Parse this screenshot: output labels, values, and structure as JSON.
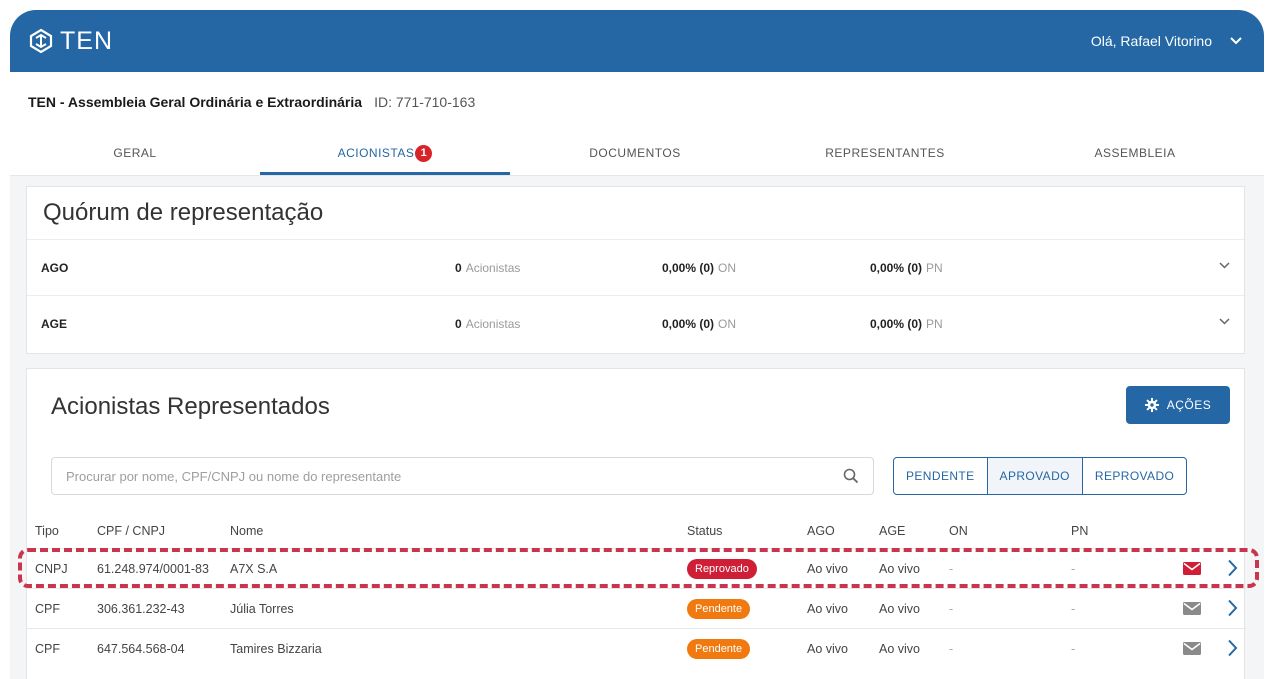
{
  "app": {
    "logo_text": "TEN",
    "user_greeting": "Olá, Rafael Vitorino"
  },
  "assembly": {
    "title": "TEN - Assembleia Geral Ordinária e Extraordinária",
    "id": "ID: 771-710-163"
  },
  "tabs": [
    {
      "label": "GERAL"
    },
    {
      "label": "ACIONISTAS",
      "badge": "1",
      "active": true
    },
    {
      "label": "DOCUMENTOS"
    },
    {
      "label": "REPRESENTANTES"
    },
    {
      "label": "ASSEMBLEIA"
    }
  ],
  "quorum": {
    "title": "Quórum de representação",
    "rows": [
      {
        "label": "AGO",
        "count": "0",
        "count_unit": "Acionistas",
        "on": "0,00% (0)",
        "on_unit": "ON",
        "pn": "0,00% (0)",
        "pn_unit": "PN"
      },
      {
        "label": "AGE",
        "count": "0",
        "count_unit": "Acionistas",
        "on": "0,00% (0)",
        "on_unit": "ON",
        "pn": "0,00% (0)",
        "pn_unit": "PN"
      }
    ]
  },
  "acionistas": {
    "title": "Acionistas Representados",
    "actions_label": "AÇÕES",
    "search_placeholder": "Procurar por nome, CPF/CNPJ ou nome do representante",
    "filters": [
      "PENDENTE",
      "APROVADO",
      "REPROVADO"
    ],
    "columns": {
      "tipo": "Tipo",
      "cpf": "CPF / CNPJ",
      "nome": "Nome",
      "status": "Status",
      "ago": "AGO",
      "age": "AGE",
      "on": "ON",
      "pn": "PN"
    },
    "rows": [
      {
        "tipo": "CNPJ",
        "cpf": "61.248.974/0001-83",
        "nome": "A7X S.A",
        "status": "Reprovado",
        "ago": "Ao vivo",
        "age": "Ao vivo",
        "on": "-",
        "pn": "-"
      },
      {
        "tipo": "CPF",
        "cpf": "306.361.232-43",
        "nome": "Júlia Torres",
        "status": "Pendente",
        "ago": "Ao vivo",
        "age": "Ao vivo",
        "on": "-",
        "pn": "-"
      },
      {
        "tipo": "CPF",
        "cpf": "647.564.568-04",
        "nome": "Tamires Bizzaria",
        "status": "Pendente",
        "ago": "Ao vivo",
        "age": "Ao vivo",
        "on": "-",
        "pn": "-"
      }
    ]
  },
  "colors": {
    "primary": "#2467a4",
    "danger": "#cf1f36",
    "warning": "#f07a10",
    "highlight": "#c9354e"
  },
  "icons": [
    "ten-logo-icon",
    "chevron-down-icon",
    "gear-icon",
    "search-icon",
    "mail-icon",
    "chevron-right-icon"
  ]
}
